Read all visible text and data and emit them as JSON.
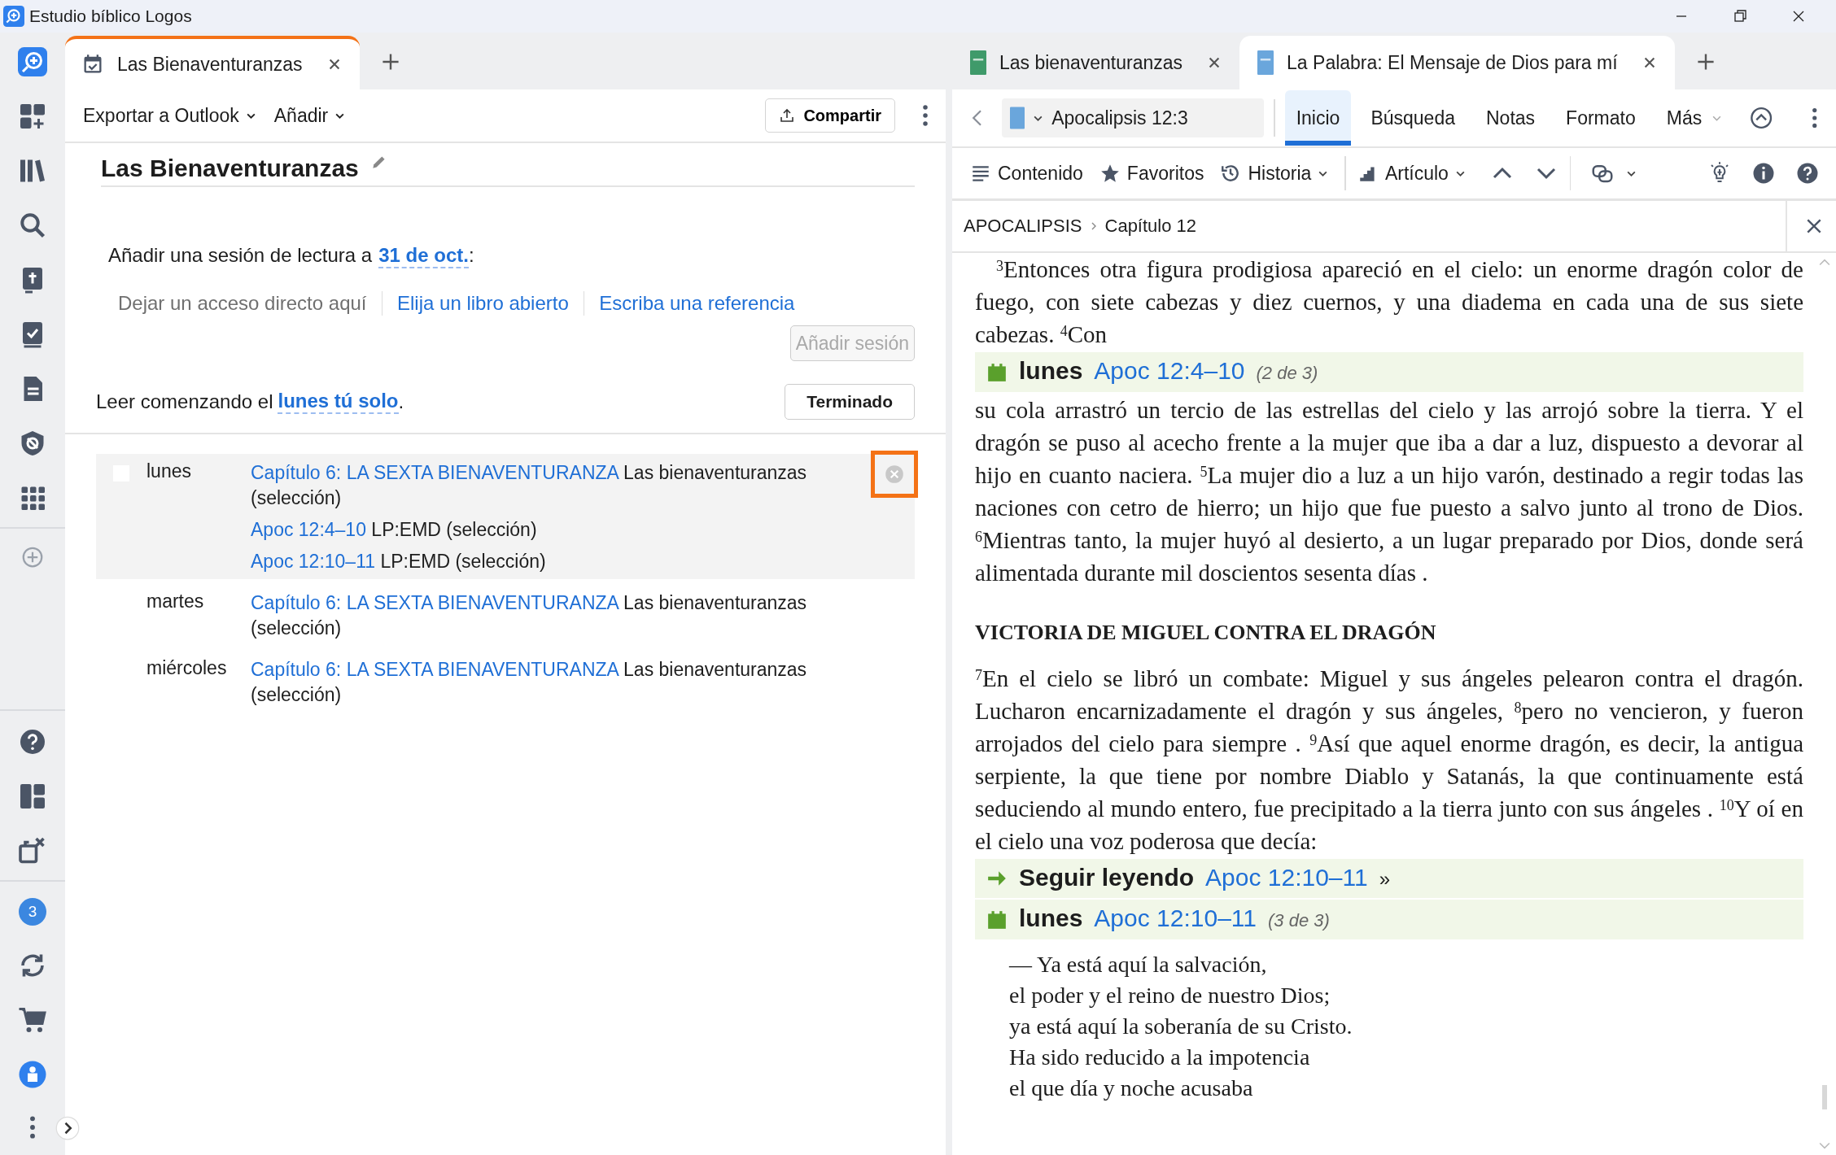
{
  "window": {
    "title": "Estudio bíblico Logos"
  },
  "sidebar": {
    "badge": "3"
  },
  "left_pane": {
    "tab": {
      "label": "Las Bienaventuranzas",
      "selected": true
    },
    "menus": [
      "Exportar a Outlook",
      "Añadir"
    ],
    "share_button": "Compartir",
    "plan_title": "Las Bienaventuranzas",
    "add_session": {
      "prefix": "Añadir una sesión de lectura a",
      "date": "31 de oct.",
      "suffix": ":"
    },
    "shortcut_options": [
      {
        "label": "Dejar un acceso directo aquí",
        "kind": "hint"
      },
      {
        "label": "Elija un libro abierto",
        "kind": "link"
      },
      {
        "label": "Escriba una referencia",
        "kind": "link"
      }
    ],
    "add_session_button": {
      "label": "Añadir sesión",
      "disabled": true
    },
    "start": {
      "prefix": "Leer comenzando el",
      "link": "lunes tú solo",
      "suffix": "."
    },
    "done_button": "Terminado",
    "schedule": [
      {
        "day": "lunes",
        "selected": true,
        "checked": false,
        "readings": [
          {
            "ref": "Capítulo 6: LA SEXTA BIENAVENTURANZA",
            "source": "Las bienaventuranzas (selección)"
          },
          {
            "ref": "Apoc 12:4–10",
            "source": "LP:EMD (selección)"
          },
          {
            "ref": "Apoc 12:10–11",
            "source": "LP:EMD (selección)"
          }
        ]
      },
      {
        "day": "martes",
        "selected": false,
        "readings": [
          {
            "ref": "Capítulo 6: LA SEXTA BIENAVENTURANZA",
            "source": "Las bienaventuranzas (selección)"
          }
        ]
      },
      {
        "day": "miércoles",
        "selected": false,
        "readings": [
          {
            "ref": "Capítulo 6: LA SEXTA BIENAVENTURANZA",
            "source": "Las bienaventuranzas (selección)"
          }
        ]
      }
    ]
  },
  "right_pane": {
    "tabs": [
      {
        "label": "Las bienaventuranzas",
        "selected": false,
        "color": "#3f9a6a"
      },
      {
        "label": "La Palabra: El Mensaje de Dios para mí",
        "selected": true,
        "color": "#6aa6dc"
      }
    ],
    "reference": "Apocalipsis 12:3",
    "ribbon_tabs": [
      {
        "label": "Inicio",
        "selected": true
      },
      {
        "label": "Búsqueda",
        "selected": false
      },
      {
        "label": "Notas",
        "selected": false
      },
      {
        "label": "Formato",
        "selected": false
      },
      {
        "label": "Más",
        "selected": false
      }
    ],
    "toolbar": [
      {
        "label": "Contenido",
        "kind": "contents"
      },
      {
        "label": "Favoritos",
        "kind": "favorites"
      },
      {
        "label": "Historia",
        "kind": "history"
      },
      {
        "label": "Artículo",
        "kind": "article"
      }
    ],
    "breadcrumb": [
      "APOCALIPSIS",
      "Capítulo 12"
    ],
    "content": [
      {
        "kind": "paragraph",
        "indent": true,
        "text": "$^{3}$Entonces otra figura prodigiosa apareció en el cielo: un enorme dragón color de fuego, con siete cabezas y diez cuernos, y una diadema en cada una de sus siete cabezas. $^{4}$Con"
      },
      {
        "kind": "reading",
        "title": "lunes",
        "ref": "Apoc 12:4–10",
        "note": "(2 de 3)"
      },
      {
        "kind": "paragraph",
        "indent": false,
        "text": "su cola arrastró un tercio de las estrellas del cielo y las arrojó sobre la tierra. Y el dragón se puso al acecho frente a la mujer que iba a dar a luz, dispuesto a devorar al hijo en cuanto naciera. $^{5}$La mujer dio a luz a un hijo varón, destinado a regir todas las naciones con cetro de hierro; un hijo que fue puesto a salvo junto al trono de Dios. $^{6}$Mientras tanto, la mujer huyó al desierto, a un lugar preparado por Dios, donde será alimentada durante mil doscientos sesenta días ."
      },
      {
        "kind": "heading",
        "text": "VICTORIA DE MIGUEL CONTRA EL DRAGÓN"
      },
      {
        "kind": "paragraph",
        "indent": false,
        "text": "$^{7}$En el cielo se libró un combate: Miguel y sus ángeles pelearon contra el dragón. Lucharon encarnizadamente el dragón y sus ángeles, $^{8}$pero no vencieron, y fueron arrojados del cielo para siempre . $^{9}$Así que aquel enorme dragón, es decir, la antigua serpiente, la que tiene por nombre Diablo y Satanás, la que continuamente está seduciendo al mundo entero, fue precipitado a la tierra junto con sus ángeles . $^{10}$Y oí en el cielo una voz poderosa que decía:"
      },
      {
        "kind": "continue",
        "title": "Seguir leyendo",
        "ref": "Apoc 12:10–11",
        "mark": "»"
      },
      {
        "kind": "reading",
        "title": "lunes",
        "ref": "Apoc 12:10–11",
        "note": "(3 de 3)"
      },
      {
        "kind": "poetry",
        "lines": [
          "— Ya está aquí la salvación,",
          "el poder y el reino de nuestro Dios;",
          "ya está aquí la soberanía de su Cristo.",
          "Ha sido reducido a la impotencia",
          "el que día y noche acusaba"
        ]
      }
    ]
  }
}
